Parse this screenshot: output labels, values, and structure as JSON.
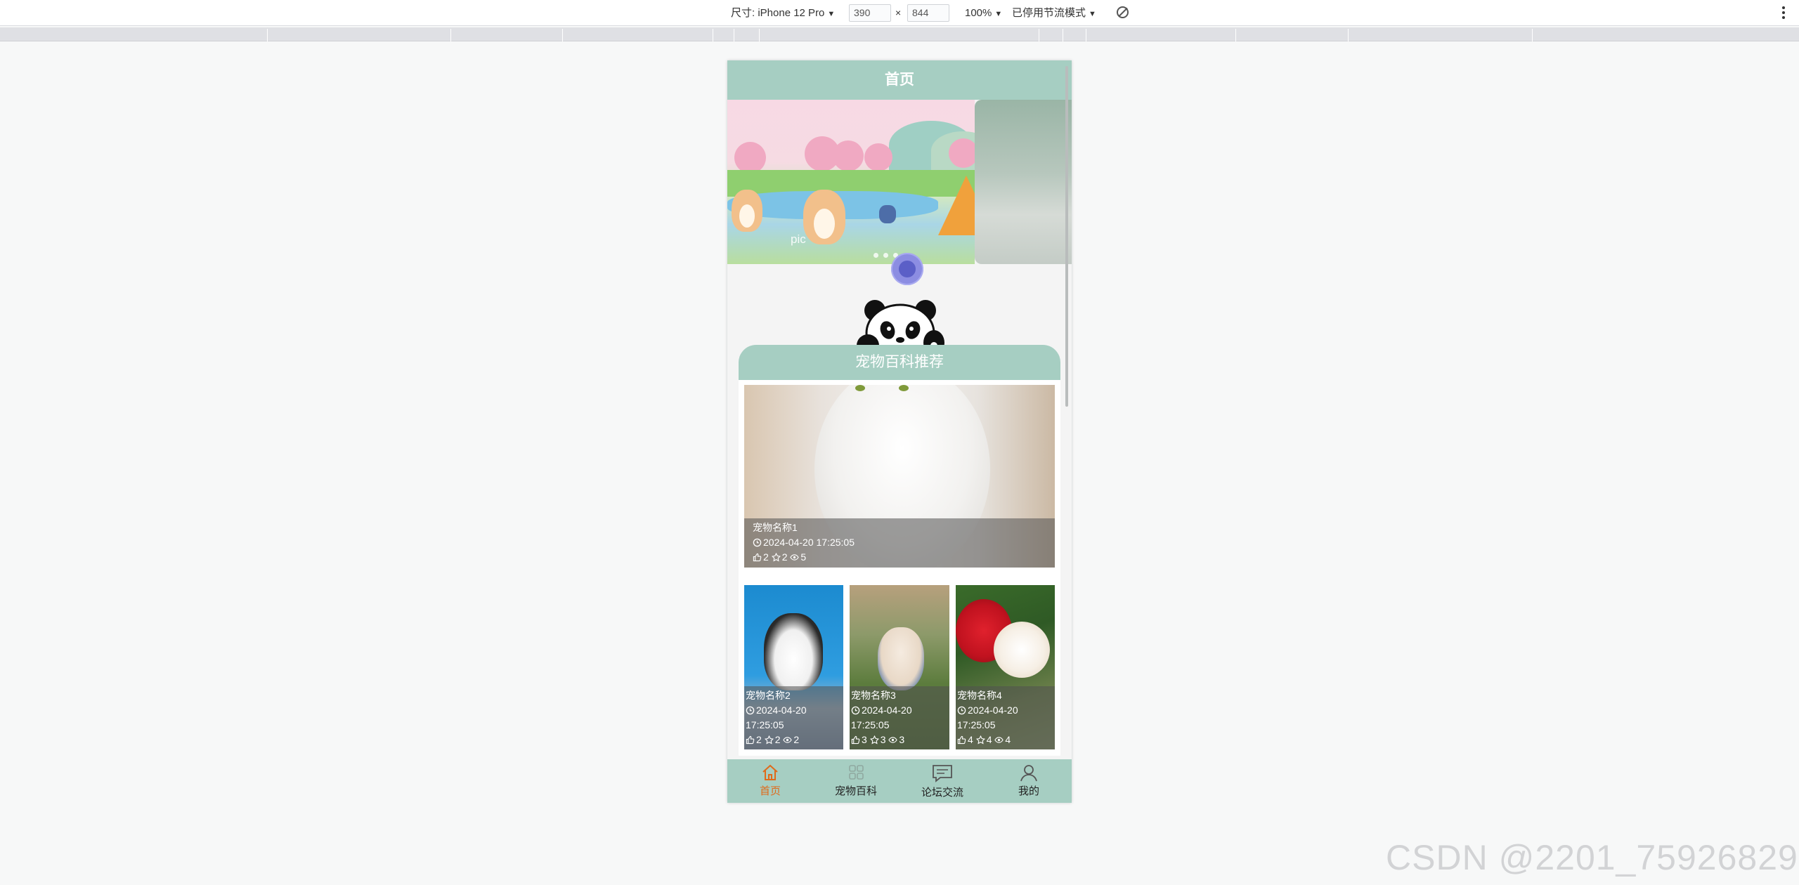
{
  "devtools": {
    "device_label": "尺寸: iPhone 12 Pro",
    "width_value": "390",
    "times": "×",
    "height_value": "844",
    "zoom": "100%",
    "throttle": "已停用节流模式",
    "caret": "▼"
  },
  "app": {
    "header_title": "首页",
    "banner_caption": "pic",
    "section_title": "宠物百科推荐",
    "featured": {
      "name": "宠物名称1",
      "date": "2024-04-20 17:25:05",
      "likes": "2",
      "stars": "2",
      "views": "5"
    },
    "cards": [
      {
        "name": "宠物名称2",
        "date_line1": "2024-04-20",
        "date_line2": "17:25:05",
        "likes": "2",
        "stars": "2",
        "views": "2"
      },
      {
        "name": "宠物名称3",
        "date_line1": "2024-04-20",
        "date_line2": "17:25:05",
        "likes": "3",
        "stars": "3",
        "views": "3"
      },
      {
        "name": "宠物名称4",
        "date_line1": "2024-04-20",
        "date_line2": "17:25:05",
        "likes": "4",
        "stars": "4",
        "views": "4"
      }
    ],
    "nav": [
      {
        "label": "首页",
        "icon": "home-icon"
      },
      {
        "label": "宠物百科",
        "icon": "grid-icon"
      },
      {
        "label": "论坛交流",
        "icon": "chat-icon"
      },
      {
        "label": "我的",
        "icon": "user-icon"
      }
    ],
    "colors": {
      "theme": "#a6cec2",
      "active_nav": "#e06a1a",
      "float_ball": "#5b5fc7"
    }
  },
  "watermark": "CSDN @2201_75926829"
}
